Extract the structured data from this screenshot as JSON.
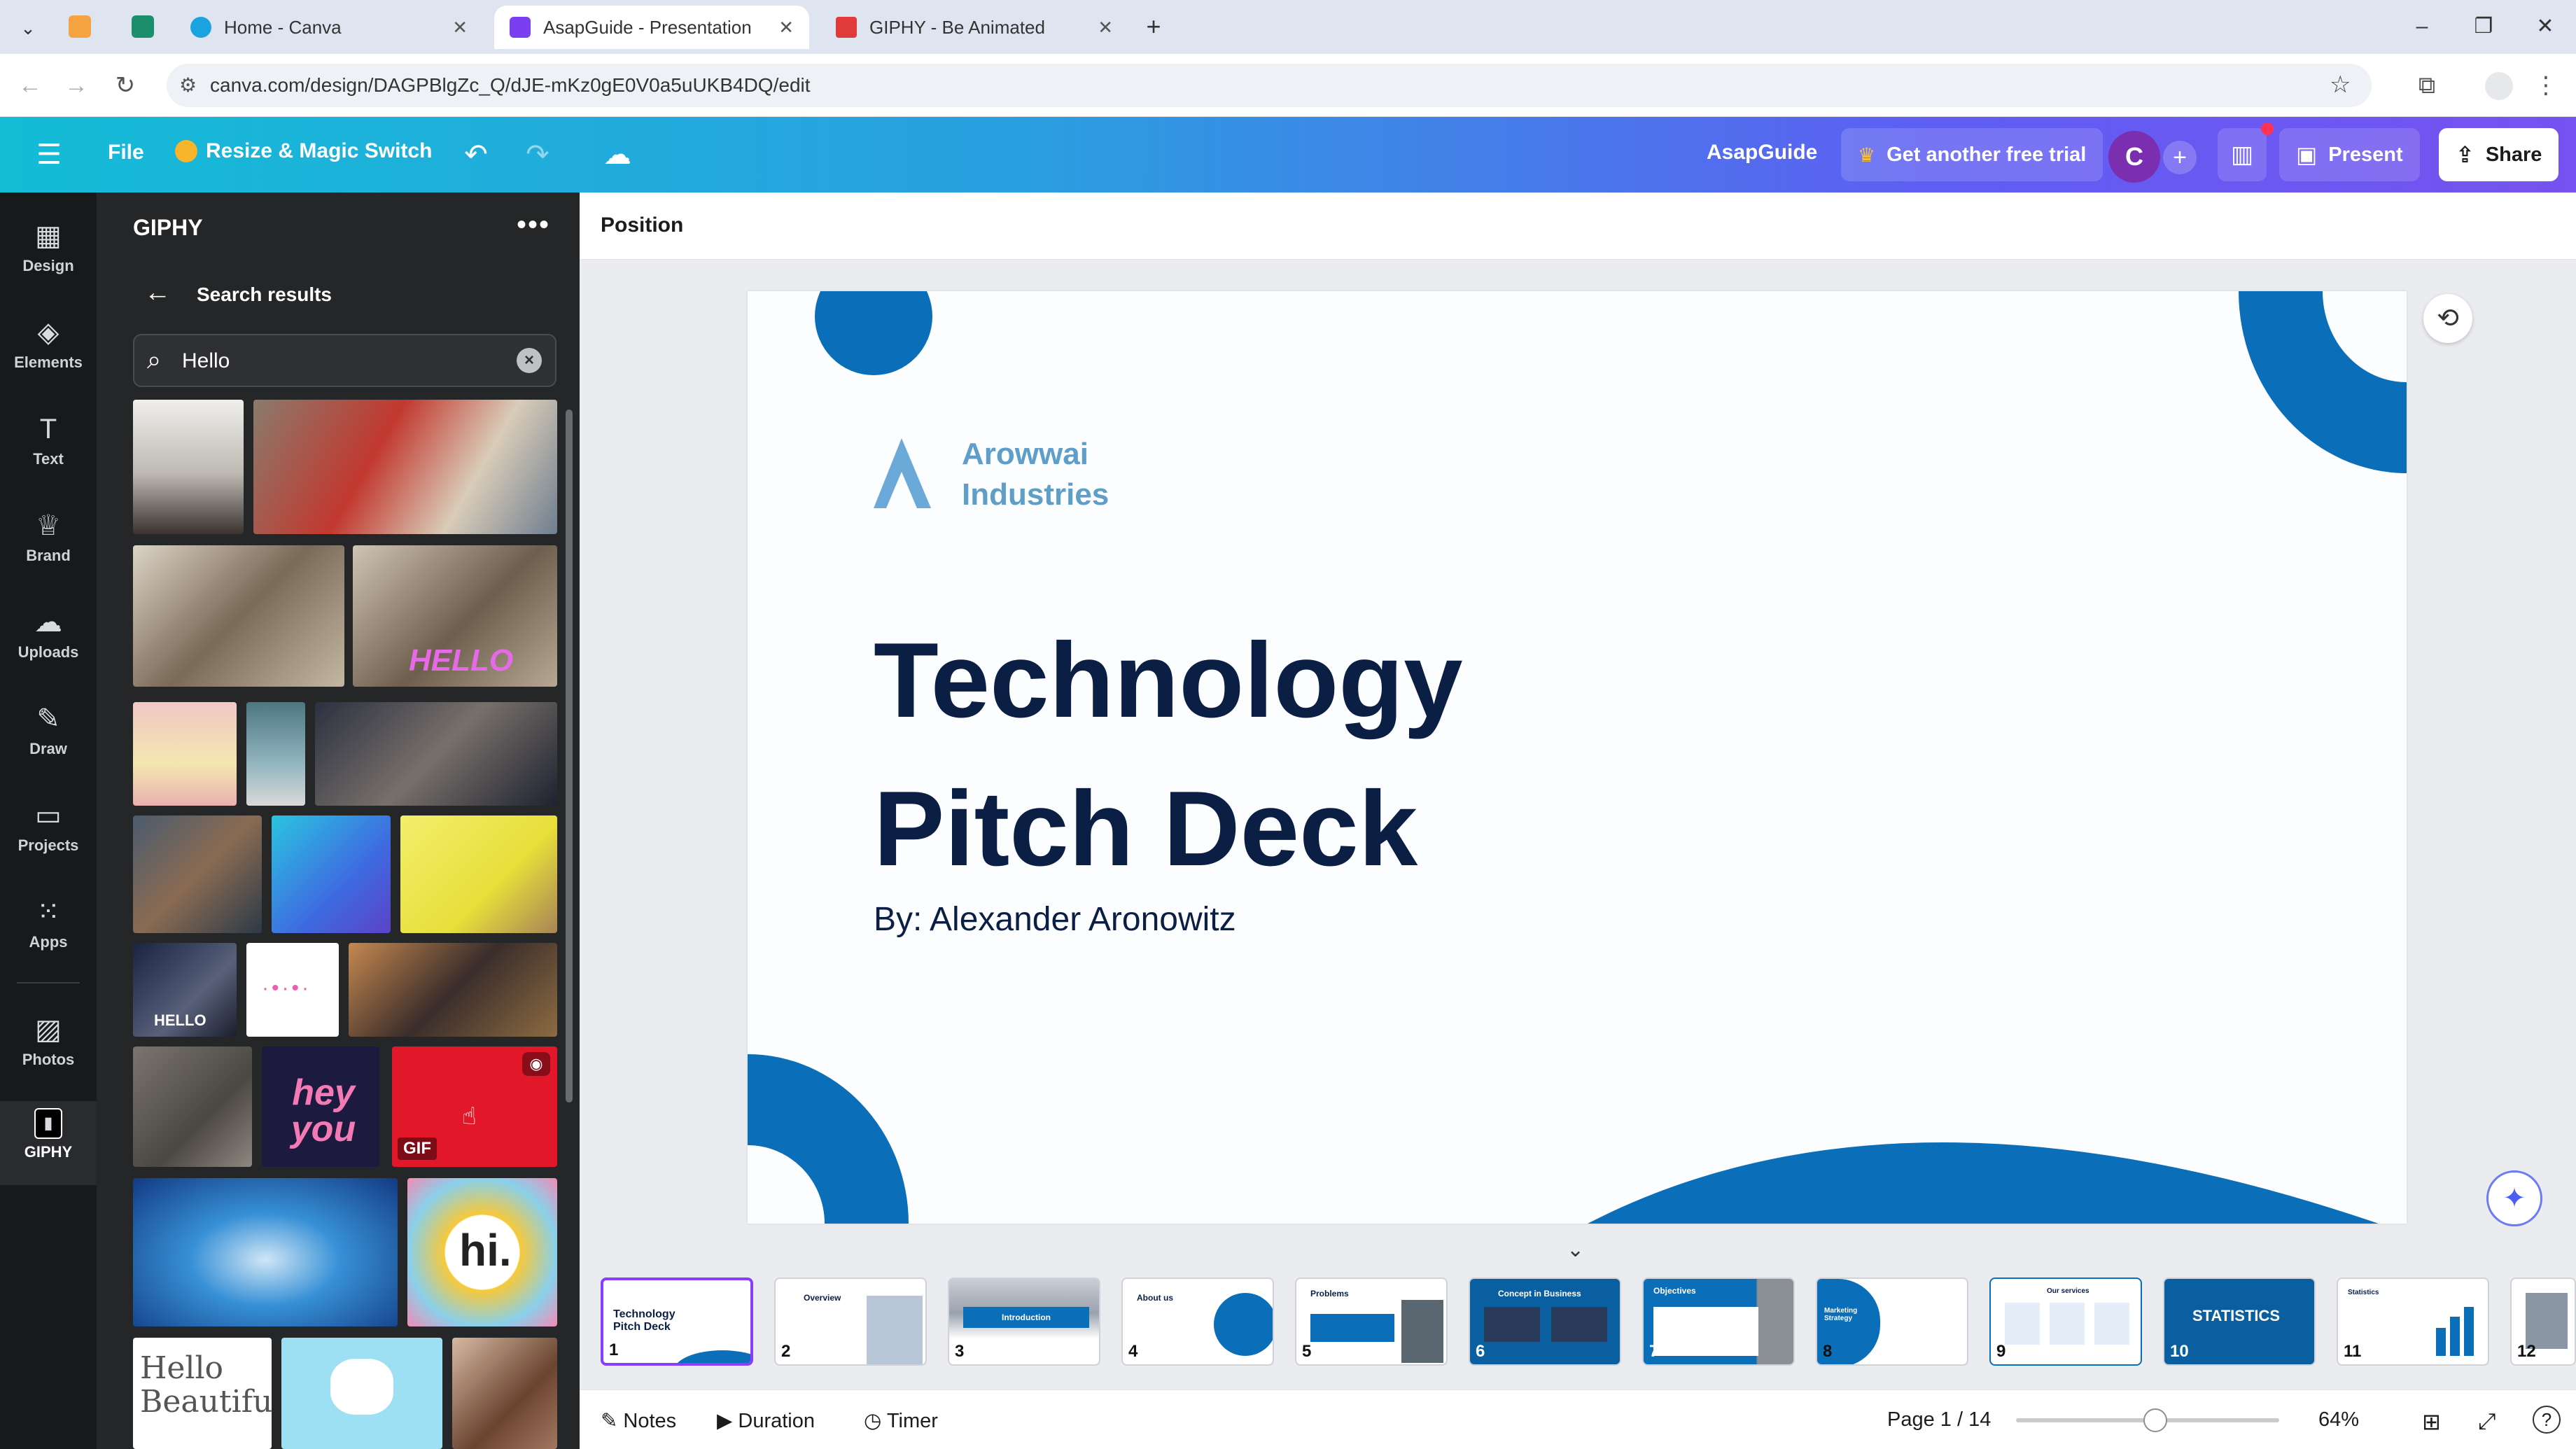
{
  "browser": {
    "tabs": [
      {
        "label": "Home - Canva",
        "active": false,
        "color": "#1aa3de"
      },
      {
        "label": "AsapGuide - Presentation",
        "active": true,
        "color": "#7b3ff2"
      },
      {
        "label": "GIPHY - Be Animated",
        "active": false,
        "color": "#e03a3a"
      }
    ],
    "url": "canva.com/design/DAGPBlgZc_Q/dJE-mKz0gE0V0a5uUKB4DQ/edit"
  },
  "toolbar": {
    "file_label": "File",
    "resize_label": "Resize & Magic Switch",
    "project_name": "AsapGuide",
    "trial_label": "Get another free trial",
    "avatar_letter": "C",
    "present_label": "Present",
    "share_label": "Share"
  },
  "rail": {
    "items": [
      {
        "label": "Design",
        "icon": "design-icon"
      },
      {
        "label": "Elements",
        "icon": "elements-icon"
      },
      {
        "label": "Text",
        "icon": "text-icon"
      },
      {
        "label": "Brand",
        "icon": "brand-icon"
      },
      {
        "label": "Uploads",
        "icon": "uploads-icon"
      },
      {
        "label": "Draw",
        "icon": "draw-icon"
      },
      {
        "label": "Projects",
        "icon": "projects-icon"
      },
      {
        "label": "Apps",
        "icon": "apps-icon"
      },
      {
        "label": "Photos",
        "icon": "photos-icon"
      },
      {
        "label": "GIPHY",
        "icon": "giphy-icon"
      }
    ]
  },
  "panel": {
    "title": "GIPHY",
    "results_label": "Search results",
    "search_value": "Hello",
    "gif_captions": {
      "hello_pink": "HELLO",
      "hello_tv": "HELLO",
      "hey_you": "hey you",
      "gif_badge": "GIF",
      "hi": "hi.",
      "hello_beautiful": "Hello Beautiful"
    }
  },
  "editor": {
    "position_label": "Position",
    "slide": {
      "logo_line1": "Arowwai",
      "logo_line2": "Industries",
      "title_line1": "Technology",
      "title_line2": "Pitch Deck",
      "author": "By: Alexander Aronowitz"
    }
  },
  "thumbnails": [
    {
      "num": "1",
      "label": "Technology Pitch Deck"
    },
    {
      "num": "2",
      "label": "Overview"
    },
    {
      "num": "3",
      "label": "Introduction"
    },
    {
      "num": "4",
      "label": "About us"
    },
    {
      "num": "5",
      "label": "Problems"
    },
    {
      "num": "6",
      "label": "Concept in Business"
    },
    {
      "num": "7",
      "label": "Objectives"
    },
    {
      "num": "8",
      "label": "Marketing Strategy"
    },
    {
      "num": "9",
      "label": "Our services"
    },
    {
      "num": "10",
      "label": "STATISTICS"
    },
    {
      "num": "11",
      "label": "Statistics"
    },
    {
      "num": "12",
      "label": ""
    }
  ],
  "footer": {
    "notes_label": "Notes",
    "duration_label": "Duration",
    "timer_label": "Timer",
    "page_indicator": "Page 1 / 14",
    "zoom": "64%"
  },
  "colors": {
    "brand_blue": "#0a6fb8",
    "title_navy": "#0b1f45",
    "accent_purple": "#8b3dff"
  }
}
